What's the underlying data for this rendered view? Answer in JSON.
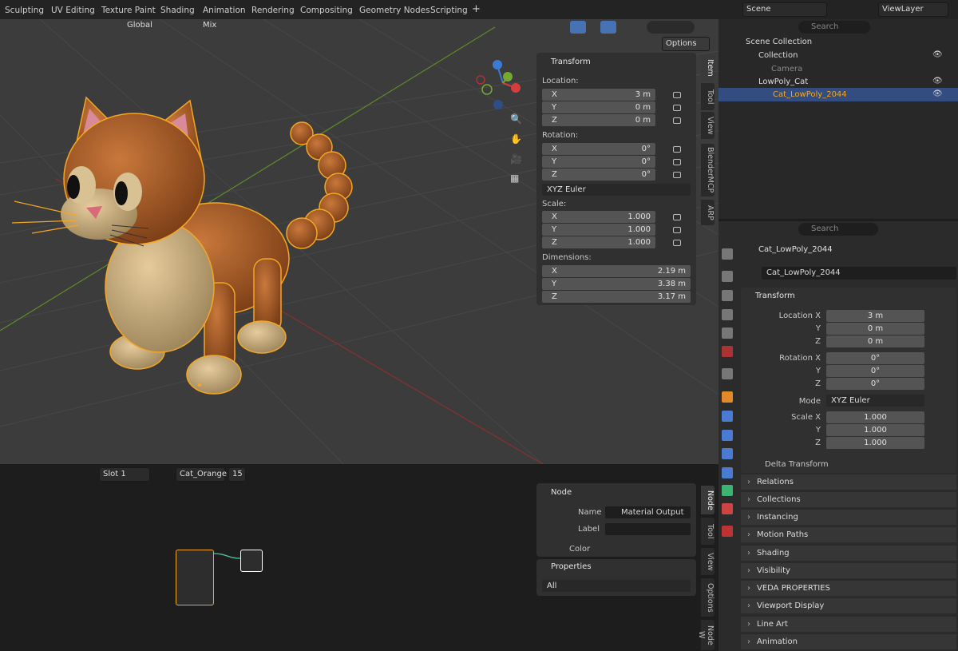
{
  "workspaces": [
    "Sculpting",
    "UV Editing",
    "Texture Paint",
    "Shading",
    "Animation",
    "Rendering",
    "Compositing",
    "Geometry Nodes",
    "Scripting",
    "+"
  ],
  "scene": {
    "name": "Scene",
    "viewlayer": "ViewLayer"
  },
  "viewport_header": {
    "orientation": "Global",
    "snap": "Mix",
    "options": "Options"
  },
  "npanel": {
    "title": "Transform",
    "location_label": "Location:",
    "rotation_label": "Rotation:",
    "scale_label": "Scale:",
    "dimensions_label": "Dimensions:",
    "location": [
      {
        "axis": "X",
        "value": "3 m"
      },
      {
        "axis": "Y",
        "value": "0 m"
      },
      {
        "axis": "Z",
        "value": "0 m"
      }
    ],
    "rotation": [
      {
        "axis": "X",
        "value": "0°"
      },
      {
        "axis": "Y",
        "value": "0°"
      },
      {
        "axis": "Z",
        "value": "0°"
      }
    ],
    "rotation_mode": "XYZ Euler",
    "scale": [
      {
        "axis": "X",
        "value": "1.000"
      },
      {
        "axis": "Y",
        "value": "1.000"
      },
      {
        "axis": "Z",
        "value": "1.000"
      }
    ],
    "dimensions": [
      {
        "axis": "X",
        "value": "2.19 m"
      },
      {
        "axis": "Y",
        "value": "3.38 m"
      },
      {
        "axis": "Z",
        "value": "3.17 m"
      }
    ]
  },
  "side_tabs": [
    "Item",
    "Tool",
    "View",
    "BlenderMCP",
    "ARP"
  ],
  "outliner": {
    "search": "Search",
    "root": "Scene Collection",
    "rows": [
      "Collection",
      "Camera",
      "LowPoly_Cat",
      "Cat_LowPoly_2044"
    ]
  },
  "properties": {
    "search": "Search",
    "object": "Cat_LowPoly_2044",
    "object_field": "Cat_LowPoly_2044",
    "transform": "Transform",
    "loc": [
      {
        "label": "Location X",
        "value": "3 m"
      },
      {
        "label": "Y",
        "value": "0 m"
      },
      {
        "label": "Z",
        "value": "0 m"
      }
    ],
    "rot": [
      {
        "label": "Rotation X",
        "value": "0°"
      },
      {
        "label": "Y",
        "value": "0°"
      },
      {
        "label": "Z",
        "value": "0°"
      }
    ],
    "mode_label": "Mode",
    "mode": "XYZ Euler",
    "scl": [
      {
        "label": "Scale X",
        "value": "1.000"
      },
      {
        "label": "Y",
        "value": "1.000"
      },
      {
        "label": "Z",
        "value": "1.000"
      }
    ],
    "delta": "Delta Transform",
    "sections": [
      "Relations",
      "Collections",
      "Instancing",
      "Motion Paths",
      "Shading",
      "Visibility",
      "VEDA PROPERTIES",
      "Viewport Display",
      "Line Art",
      "Animation"
    ]
  },
  "node_editor": {
    "slot": "Slot 1",
    "material": "Cat_Orange",
    "users": "15",
    "node_panel": {
      "title": "Node",
      "name_label": "Name",
      "name": "Material Output",
      "label_label": "Label",
      "color": "Color"
    },
    "properties_panel": {
      "title": "Properties",
      "filter": "All"
    },
    "tabs": [
      "Node",
      "Tool",
      "View",
      "Options",
      "Node W"
    ]
  },
  "colors": {
    "accent": "#4772b3",
    "selection": "#f5a623",
    "cat_body": "#b5652e",
    "cat_belly": "#d6b98a"
  }
}
